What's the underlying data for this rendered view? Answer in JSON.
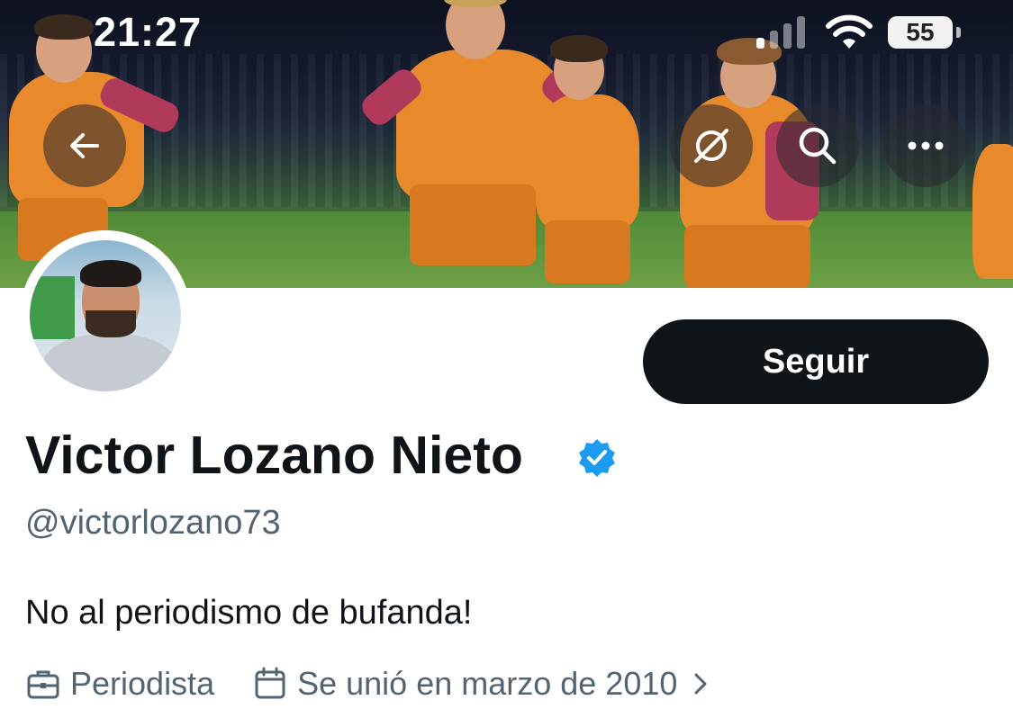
{
  "status_bar": {
    "time": "21:27",
    "battery": "55",
    "signal_bars_active": 1,
    "signal_bars_total": 4
  },
  "header": {
    "back_icon": "arrow-left-icon",
    "grok_icon": "grok-icon",
    "search_icon": "search-icon",
    "more_icon": "more-horizontal-icon"
  },
  "profile": {
    "display_name": "Victor Lozano Nieto",
    "verified": true,
    "handle": "@victorlozano73",
    "bio": "No al periodismo de bufanda!",
    "profession": "Periodista",
    "joined": "Se unió en marzo de 2010",
    "follow_label": "Seguir"
  },
  "colors": {
    "follow_button_bg": "#0f1419",
    "verified_badge": "#1d9bf0",
    "secondary_text": "#536471",
    "primary_text": "#0f1419"
  }
}
